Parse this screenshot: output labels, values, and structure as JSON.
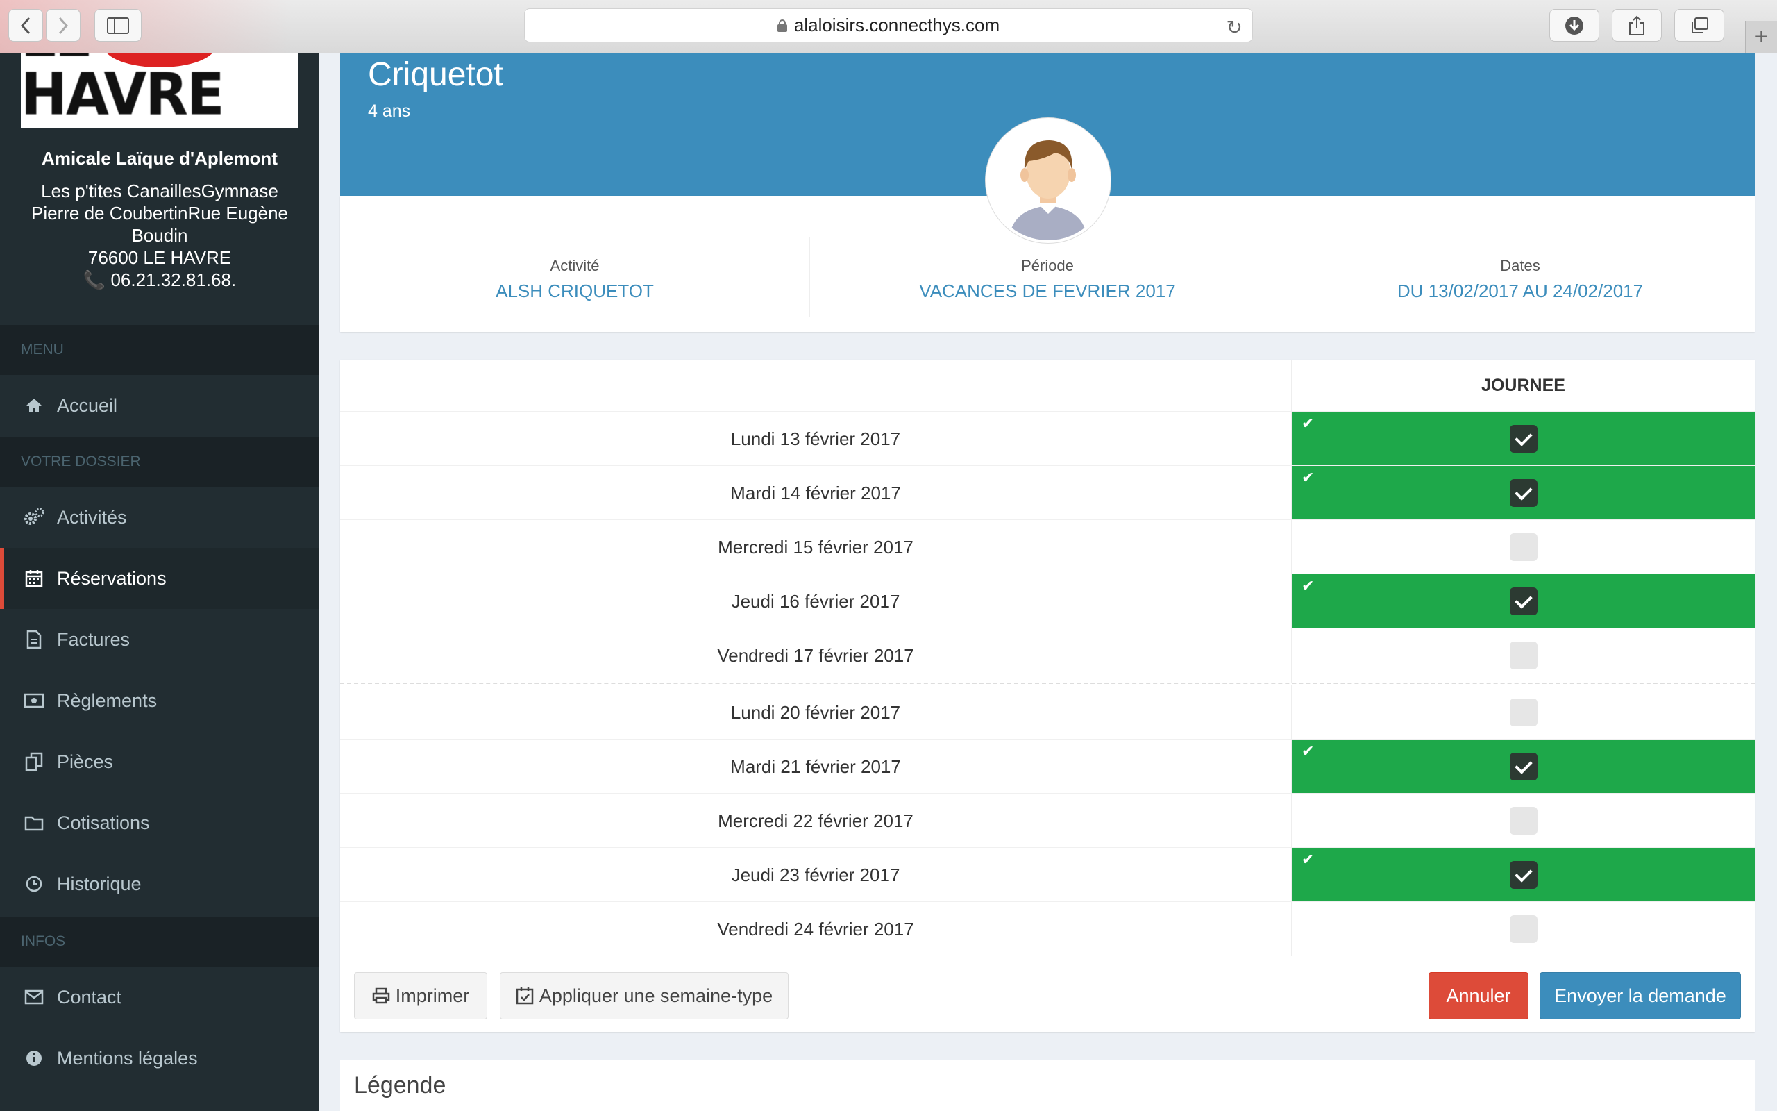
{
  "browser": {
    "url": "alaloisirs.connecthys.com"
  },
  "sidebar": {
    "logo_text": "LE HAVRE",
    "org_name": "Amicale Laïque d'Aplemont",
    "address_lines": [
      "Les p'tites CanaillesGymnase",
      "Pierre de CoubertinRue Eugène",
      "Boudin",
      "76600 LE HAVRE"
    ],
    "phone": "06.21.32.81.68.",
    "sections": {
      "menu": "MENU",
      "dossier": "VOTRE DOSSIER",
      "infos": "INFOS"
    },
    "items": [
      {
        "label": "Accueil",
        "icon": "home-icon"
      },
      {
        "label": "Activités",
        "icon": "gears-icon"
      },
      {
        "label": "Réservations",
        "icon": "calendar-icon",
        "active": true
      },
      {
        "label": "Factures",
        "icon": "file-icon"
      },
      {
        "label": "Règlements",
        "icon": "money-icon"
      },
      {
        "label": "Pièces",
        "icon": "copy-icon"
      },
      {
        "label": "Cotisations",
        "icon": "folder-icon"
      },
      {
        "label": "Historique",
        "icon": "clock-icon"
      },
      {
        "label": "Contact",
        "icon": "envelope-icon"
      },
      {
        "label": "Mentions légales",
        "icon": "info-icon"
      }
    ]
  },
  "child": {
    "name": "Criquetot",
    "age": "4 ans"
  },
  "info": {
    "activity_label": "Activité",
    "activity_value": "ALSH CRIQUETOT",
    "period_label": "Période",
    "period_value": "VACANCES DE FEVRIER 2017",
    "dates_label": "Dates",
    "dates_value": "DU 13/02/2017 AU 24/02/2017"
  },
  "table": {
    "column": "JOURNEE",
    "rows": [
      {
        "day": "Lundi 13 février 2017",
        "checked": true
      },
      {
        "day": "Mardi 14 février 2017",
        "checked": true
      },
      {
        "day": "Mercredi 15 février 2017",
        "checked": false
      },
      {
        "day": "Jeudi 16 février 2017",
        "checked": true
      },
      {
        "day": "Vendredi 17 février 2017",
        "checked": false
      },
      {
        "day": "Lundi 20 février 2017",
        "checked": false
      },
      {
        "day": "Mardi 21 février 2017",
        "checked": true
      },
      {
        "day": "Mercredi 22 février 2017",
        "checked": false
      },
      {
        "day": "Jeudi 23 février 2017",
        "checked": true
      },
      {
        "day": "Vendredi 24 février 2017",
        "checked": false
      }
    ]
  },
  "actions": {
    "print": "Imprimer",
    "apply_week": "Appliquer une semaine-type",
    "cancel": "Annuler",
    "send": "Envoyer la demande"
  },
  "legend": {
    "title": "Légende"
  },
  "colors": {
    "header": "#3c8dbc",
    "sidebar": "#222d32",
    "reserved": "#1ea84a",
    "active_marker": "#dd4b39"
  }
}
